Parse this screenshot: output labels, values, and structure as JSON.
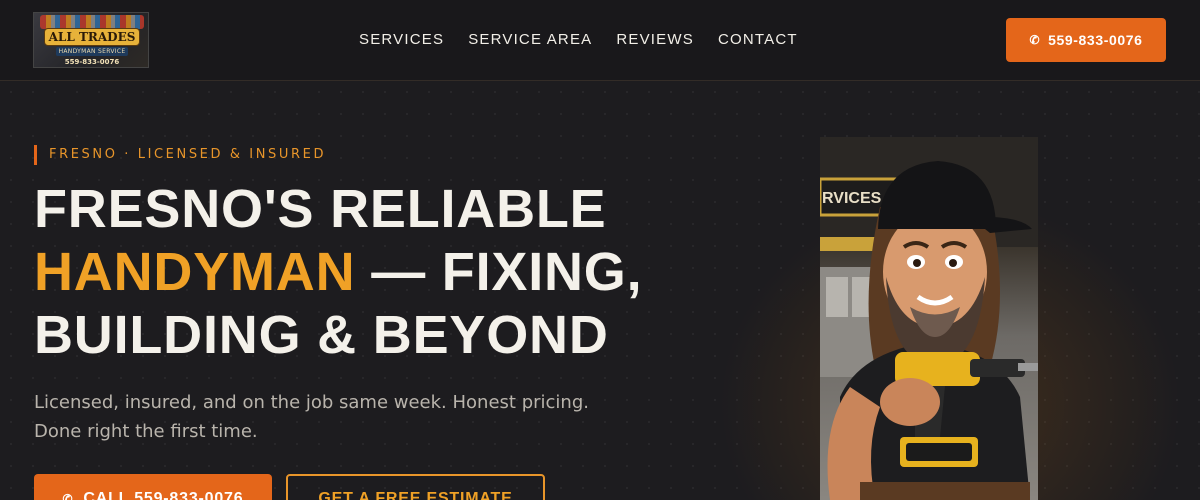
{
  "header": {
    "logo": {
      "brand": "ALL TRADES",
      "tagline": "HANDYMAN SERVICE",
      "phone": "559-833-0076"
    },
    "nav": [
      {
        "label": "SERVICES"
      },
      {
        "label": "SERVICE AREA"
      },
      {
        "label": "REVIEWS"
      },
      {
        "label": "CONTACT"
      }
    ],
    "cta": {
      "icon": "phone-icon",
      "label": "559-833-0076"
    }
  },
  "hero": {
    "eyebrow": "FRESNO · LICENSED & INSURED",
    "title_part1": "FRESNO'S RELIABLE",
    "title_accent": "HANDYMAN",
    "title_part2": " — FIXING,",
    "title_part3": "BUILDING & BEYOND",
    "subtitle": "Licensed, insured, and on the job same week. Honest pricing. Done right the first time.",
    "primary_button": {
      "icon": "phone-icon",
      "label": "CALL 559-833-0076"
    },
    "secondary_button": {
      "label": "GET A FREE ESTIMATE"
    }
  },
  "mascot": {
    "sign_text": "RVICES"
  },
  "colors": {
    "accent_orange": "#e4661a",
    "accent_gold": "#f0a126",
    "background": "#1b1a1d"
  }
}
